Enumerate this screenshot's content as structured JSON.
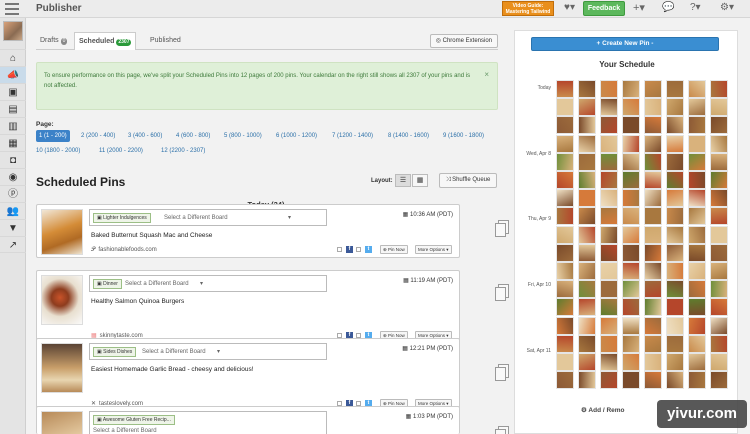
{
  "app": {
    "title": "Publisher"
  },
  "topbar": {
    "video_guide": "Video Guide: Mastering Tailwind",
    "feedback": "Feedback",
    "icons": [
      "heart-icon",
      "plus-icon",
      "chat-icon",
      "help-icon",
      "gear-icon"
    ]
  },
  "sidebar": {
    "icons": [
      "home-icon",
      "megaphone-icon",
      "inbox-icon",
      "publisher-icon",
      "analytics-icon",
      "calendar-icon",
      "instagram-icon",
      "globe-icon",
      "pinterest-icon",
      "users-icon",
      "filter-icon",
      "trends-icon"
    ],
    "active_index": 1
  },
  "tabs": [
    {
      "label": "Drafts",
      "count": "0"
    },
    {
      "label": "Scheduled",
      "count": "2307"
    },
    {
      "label": "Published",
      "count": ""
    }
  ],
  "chrome_extension": "Chrome Extension",
  "alert": {
    "text": "To ensure performance on this page, we've split your Scheduled Pins into 12 pages of 200 pins. Your calendar on the right still shows all 2307 of your pins and is not affected.",
    "close": "×"
  },
  "pagination": {
    "label": "Page:",
    "pages": [
      "1 (1 - 200)",
      "2 (200 - 400)",
      "3 (400 - 600)",
      "4 (600 - 800)",
      "5 (800 - 1000)",
      "6 (1000 - 1200)",
      "7 (1200 - 1400)",
      "8 (1400 - 1600)",
      "9 (1600 - 1800)",
      "10 (1800 - 2000)",
      "11 (2000 - 2200)",
      "12 (2200 - 2307)"
    ]
  },
  "scheduled": {
    "title": "Scheduled Pins",
    "layout_label": "Layout:",
    "shuffle": "Shuffle Queue",
    "group_label": "Today (24)"
  },
  "pins": [
    {
      "board": "Lighter Indulgences",
      "board_placeholder": "Select a Different Board",
      "time": "10:36 AM (PDT)",
      "description": "Baked Butternut Squash Mac and Cheese",
      "source": "fashionablefoods.com",
      "pin_now": "Pin Now",
      "more": "More Options"
    },
    {
      "board": "Dinner",
      "board_placeholder": "Select a Different Board",
      "time": "11:19 AM (PDT)",
      "description": "Healthy Salmon Quinoa Burgers",
      "source": "skinnytaste.com",
      "pin_now": "Pin Now",
      "more": "More Options"
    },
    {
      "board": "Sides Dishes",
      "board_placeholder": "Select a Different Board",
      "time": "12:21 PM (PDT)",
      "description": "Easiest Homemade Garlic Bread - cheesy and delicious!",
      "source": "tasteslovely.com",
      "pin_now": "Pin Now",
      "more": "More Options"
    },
    {
      "board": "Awesome Gluten Free Recip...",
      "board_placeholder": "Select a Different Board",
      "time": "1:03 PM (PDT)",
      "description": "",
      "source": "",
      "pin_now": "",
      "more": ""
    }
  ],
  "schedule": {
    "new_pin": "+ Create New Pin -",
    "title": "Your Schedule",
    "days": [
      {
        "label": "Today",
        "row": 0
      },
      {
        "label": "Wed, Apr 8",
        "row": 4
      },
      {
        "label": "Thu, Apr 9",
        "row": 7
      },
      {
        "label": "Fri, Apr 10",
        "row": 11
      },
      {
        "label": "Sat, Apr 11",
        "row": 14
      }
    ],
    "add_remove": "Add / Remo"
  },
  "watermark": "yivur.com"
}
